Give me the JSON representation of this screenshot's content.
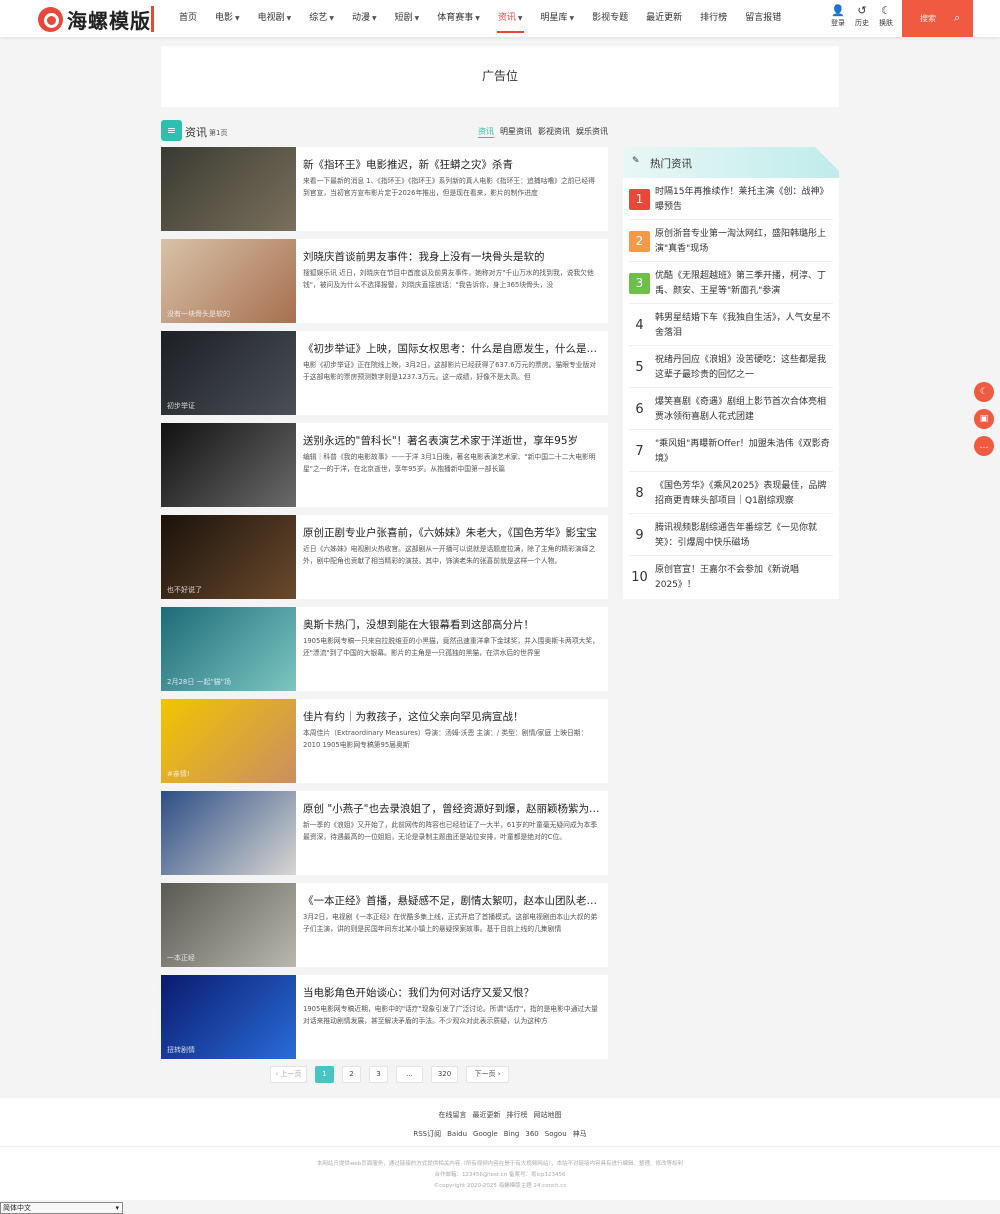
{
  "site": {
    "logo_text": "海螺模版"
  },
  "nav": [
    {
      "label": "首页",
      "dropdown": false,
      "active": false
    },
    {
      "label": "电影",
      "dropdown": true,
      "active": false
    },
    {
      "label": "电视剧",
      "dropdown": true,
      "active": false
    },
    {
      "label": "综艺",
      "dropdown": true,
      "active": false
    },
    {
      "label": "动漫",
      "dropdown": true,
      "active": false
    },
    {
      "label": "短剧",
      "dropdown": true,
      "active": false
    },
    {
      "label": "体育赛事",
      "dropdown": true,
      "active": false
    },
    {
      "label": "资讯",
      "dropdown": true,
      "active": true
    },
    {
      "label": "明星库",
      "dropdown": true,
      "active": false
    },
    {
      "label": "影视专题",
      "dropdown": false,
      "active": false
    },
    {
      "label": "最近更新",
      "dropdown": false,
      "active": false
    },
    {
      "label": "排行榜",
      "dropdown": false,
      "active": false
    },
    {
      "label": "留言报错",
      "dropdown": false,
      "active": false
    }
  ],
  "user_tools": [
    {
      "label": "登录",
      "icon": "user-icon",
      "glyph": "👤"
    },
    {
      "label": "历史",
      "icon": "history-icon",
      "glyph": "↺"
    },
    {
      "label": "换肤",
      "icon": "moon-icon",
      "glyph": "☾"
    }
  ],
  "search": {
    "placeholder": "搜索",
    "icon": "search-icon"
  },
  "ad": {
    "label": "广告位"
  },
  "list_header": {
    "title": "资讯",
    "page": "第1页",
    "tabs": [
      "资讯",
      "明星资讯",
      "影视资讯",
      "娱乐资讯"
    ],
    "active_tab": 0
  },
  "articles": [
    {
      "title": "新《指环王》电影推迟，新《狂蟒之灾》杀青",
      "desc": "来看一下最新的消息 1、《指环王》《指环王》系列新的真人电影《指环王：追捕咕噜》之前已经得到官宣，当初官方宣布影片定于2026年推出，但是现在看来，影片的制作进度",
      "thumb_colors": [
        "#3a3a32",
        "#7a705c"
      ],
      "caption": ""
    },
    {
      "title": "刘晓庆首谈前男友事件：我身上没有一块骨头是软的",
      "desc": "搜狐娱乐讯 近日，刘晓庆在节目中首度谈及前男友事件，她称对方\"千山万水的找到我，说我欠他钱\"，被问及为什么不选择报警，刘晓庆直接放话：\"我告诉你，身上365块骨头，没",
      "thumb_colors": [
        "#d8c2a8",
        "#a86f50"
      ],
      "caption": "没有一块骨头是软的"
    },
    {
      "title": "《初步举证》上映，国际女权思考：什么是自愿发生，什么是强迫？",
      "desc": "电影《初步举证》正在院线上映，3月2日，这部影片已经获得了637.6万元的票房。猫眼专业版对于这部电影的票房预测数字则是1237.3万元。这一成绩，好像不是太高。但",
      "thumb_colors": [
        "#1c1f24",
        "#4a4f58"
      ],
      "caption": "初步举证"
    },
    {
      "title": "送别永远的\"曾科长\"！著名表演艺术家于洋逝世，享年95岁",
      "desc": "编辑｜科普《我的电影故事》——于洋 3月1日晚，著名电影表演艺术家、\"新中国二十二大电影明星\"之一的于洋，在北京逝世，享年95岁。从抱播新中国第一部长篇",
      "thumb_colors": [
        "#111111",
        "#6a6a6a"
      ],
      "caption": ""
    },
    {
      "title": "原创正剧专业户张喜前，《六姊妹》朱老大，《国色芳华》影宝宝",
      "desc": "近日《六姊妹》电视剧火热收官。这部剧从一开播可以说就是话题度拉满，除了主角的精彩演绎之外，剧中配角也贡献了相当精彩的演技。其中，饰演老朱的张喜前就是这样一个人物。",
      "thumb_colors": [
        "#1a120c",
        "#6b4a2c"
      ],
      "caption": "也不好说了"
    },
    {
      "title": "奥斯卡热门，没想到能在大银幕看到这部高分片！",
      "desc": "1905电影网专稿一只来自拉脱维亚的小黑猫，竟然迅速重洋拿下金球奖，并入围奥斯卡两项大奖，还\"漂流\"到了中国的大银幕。影片的主角是一只孤独的黑猫，在洪水后的世界里",
      "thumb_colors": [
        "#1e6b78",
        "#7cc7c2"
      ],
      "caption": "2月28日 一起\"猫\"场"
    },
    {
      "title": "佳片有约｜为救孩子，这位父亲向罕见病宣战！",
      "desc": "本周佳片（Extraordinary Measures）导演：汤姆·沃恩 主演：/ 类型：剧情/家庭 上映日期：2010 1905电影网专稿第95届奥斯",
      "thumb_colors": [
        "#f3c400",
        "#c98f62"
      ],
      "caption": "#亲情!"
    },
    {
      "title": "原创 \"小燕子\"也去录浪姐了，曾经资源好到爆，赵丽颖杨紫为其当配",
      "desc": "新一季的《浪姐》又开始了，此前网传的阵容也已经验证了一大半，61岁的叶童毫无疑问成为本季最资深，待遇最高的一位姐姐，无论是录制主题曲还是站位安排，叶童都是绝对的C位。",
      "thumb_colors": [
        "#2c4e86",
        "#d8d6d2"
      ],
      "caption": ""
    },
    {
      "title": "《一本正经》首播，悬疑感不足，剧情太絮叨，赵本山团队老戏骨都显",
      "desc": "3月2日，电视剧《一本正经》在优酷多集上线，正式开启了首播模式。这部电视剧由本山大叔的弟子们主演，讲的则是民国年间东北某小镇上的悬疑探案故事。基于目前上线的几集剧情",
      "thumb_colors": [
        "#5a5a52",
        "#b9b7ae"
      ],
      "caption": "一本正经"
    },
    {
      "title": "当电影角色开始谈心：我们为何对话疗又爱又恨？",
      "desc": "1905电影网专稿近期，电影中的\"话疗\"现象引发了广泛讨论。所谓\"话疗\"，指的是电影中通过大量对话来推动剧情发展，甚至解决矛盾的手法。不少观众对此表示质疑，认为这种方",
      "thumb_colors": [
        "#0a1b6e",
        "#2a6cd8"
      ],
      "caption": "扭转剧情"
    }
  ],
  "pagination": {
    "prev": "‹ 上一页",
    "pages": [
      "1",
      "2",
      "3",
      "...",
      "320"
    ],
    "current": "1",
    "next": "下一页 ›"
  },
  "sidebar": {
    "title": "热门资讯",
    "items": [
      {
        "rank": "1",
        "text": "时隔15年再推续作！莱托主演《创：战神》曝预告"
      },
      {
        "rank": "2",
        "text": "原创浙音专业第一淘汰网红，盛阳韩璐彤上演\"真香\"现场"
      },
      {
        "rank": "3",
        "text": "优酷《无限超越班》第三季开播，柯淳、丁禹、颜安、王星等\"新面孔\"参演"
      },
      {
        "rank": "4",
        "text": "韩男星结婚下车《我独自生活》，人气女星不舍落泪"
      },
      {
        "rank": "5",
        "text": "祝绪丹回应《浪姐》没苦硬吃：这些都是我这辈子最珍贵的回忆之一"
      },
      {
        "rank": "6",
        "text": "爆笑喜剧《奇遇》剧组上影节首次合体亮相 贾冰领衔喜剧人花式团建"
      },
      {
        "rank": "7",
        "text": "\"乘风姐\"再曝新Offer！加盟朱浩伟《双影奇境》"
      },
      {
        "rank": "8",
        "text": "《国色芳华》《乘风2025》表现最佳，品牌招商更青睐头部项目｜Q1剧综观察"
      },
      {
        "rank": "9",
        "text": "腾讯视频影剧综通告年番综艺《一见你就笑》：引爆周中快乐磁场"
      },
      {
        "rank": "10",
        "text": "原创官宣！王嘉尔不会参加《新说唱2025》！"
      }
    ],
    "rank_colors": [
      "#e8473a",
      "#f2994a",
      "#6cc04a"
    ]
  },
  "float_buttons": [
    {
      "icon": "moon-icon",
      "glyph": "☾"
    },
    {
      "icon": "book-icon",
      "glyph": "▣"
    },
    {
      "icon": "chat-icon",
      "glyph": "…"
    }
  ],
  "footer": {
    "links": [
      "在线留言",
      "最近更新",
      "排行榜",
      "网站地图"
    ],
    "links2": [
      "RSS订阅",
      "Baidu",
      "Google",
      "Bing",
      "360",
      "Sogou",
      "神马"
    ],
    "disclaimer": "本网站只提供web页面服务，通过链接的方式提供相关内容（所有视频内容在是于有大视频网站），本站不对链接内容具有进行编辑、整理、修改等权利",
    "contact": "合作邮箱：123456@test.cn 备案号：粤icp123456",
    "copyright": "©copyright 2020-2025 海螺模版主题 24.conch.cc"
  },
  "lang_select": {
    "value": "简体中文"
  }
}
